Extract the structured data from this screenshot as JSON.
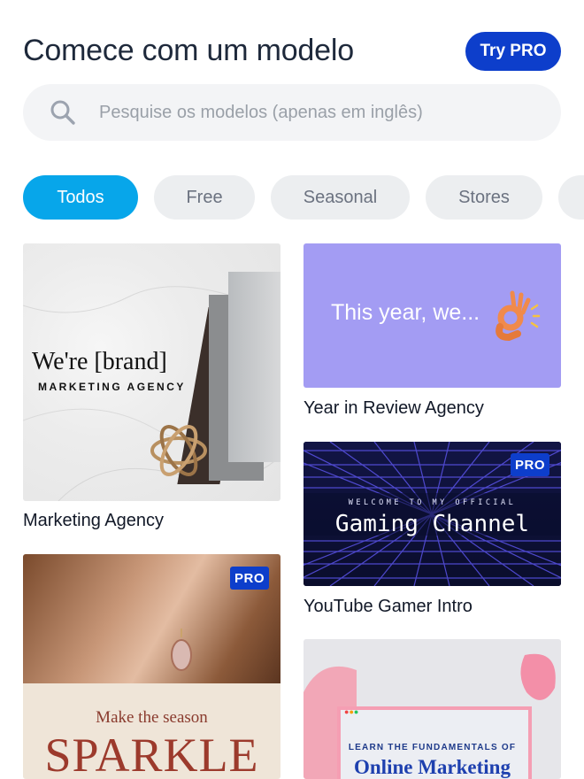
{
  "header": {
    "title": "Comece com um modelo",
    "try_pro": "Try PRO"
  },
  "search": {
    "placeholder": "Pesquise os modelos (apenas em inglês)",
    "value": ""
  },
  "categories": [
    {
      "label": "Todos",
      "active": true
    },
    {
      "label": "Free",
      "active": false
    },
    {
      "label": "Seasonal",
      "active": false
    },
    {
      "label": "Stores",
      "active": false
    }
  ],
  "templates": {
    "marketing_agency": {
      "label": "Marketing Agency",
      "headline": "We're [brand]",
      "subline": "MARKETING AGENCY",
      "pro": false
    },
    "year_review": {
      "label": "Year in Review Agency",
      "headline": "This year, we...",
      "pro": false
    },
    "youtube_gamer": {
      "label": "YouTube Gamer Intro",
      "small_text": "WELCOME TO MY OFFICIAL",
      "headline": "Gaming Channel",
      "pro": true,
      "badge": "PRO"
    },
    "sparkle": {
      "headline_small": "Make the season",
      "headline": "SPARKLE",
      "pro": true,
      "badge": "PRO"
    },
    "online_marketing": {
      "small_text": "LEARN THE FUNDAMENTALS OF",
      "headline": "Online Marketing"
    }
  },
  "colors": {
    "accent": "#07a6ea",
    "pro": "#0d3ecb",
    "lavender": "#a39cf3"
  }
}
